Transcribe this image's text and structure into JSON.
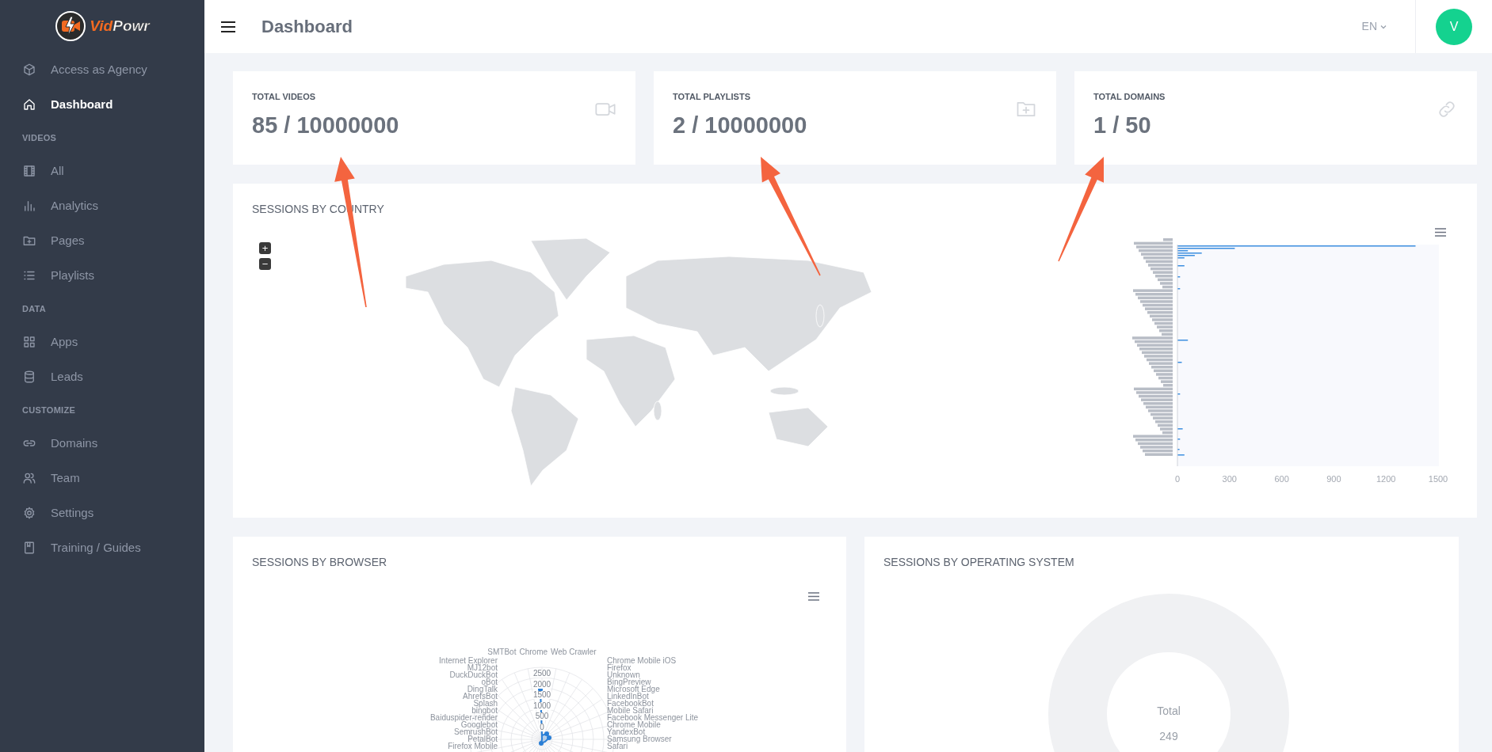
{
  "sidebar": {
    "logo": [
      "Vid",
      "Powr"
    ],
    "items": [
      {
        "kind": "link",
        "label": "Access as Agency",
        "selected": false
      },
      {
        "kind": "link",
        "label": "Dashboard",
        "selected": true
      },
      {
        "kind": "section",
        "label": "VIDEOS"
      },
      {
        "kind": "link",
        "label": "All",
        "selected": false
      },
      {
        "kind": "link",
        "label": "Analytics",
        "selected": false
      },
      {
        "kind": "link",
        "label": "Pages",
        "selected": false
      },
      {
        "kind": "link",
        "label": "Playlists",
        "selected": false
      },
      {
        "kind": "section",
        "label": "DATA"
      },
      {
        "kind": "link",
        "label": "Apps",
        "selected": false
      },
      {
        "kind": "link",
        "label": "Leads",
        "selected": false
      },
      {
        "kind": "section",
        "label": "CUSTOMIZE"
      },
      {
        "kind": "link",
        "label": "Domains",
        "selected": false
      },
      {
        "kind": "link",
        "label": "Team",
        "selected": false
      },
      {
        "kind": "link",
        "label": "Settings",
        "selected": false
      },
      {
        "kind": "link",
        "label": "Training / Guides",
        "selected": false
      }
    ]
  },
  "header": {
    "title": "Dashboard",
    "language": "EN",
    "avatar": "V"
  },
  "stats": [
    {
      "label": "TOTAL VIDEOS",
      "value": "85 / 10000000"
    },
    {
      "label": "TOTAL PLAYLISTS",
      "value": "2 / 10000000"
    },
    {
      "label": "TOTAL DOMAINS",
      "value": "1 / 50"
    }
  ],
  "country": {
    "title": "SESSIONS BY COUNTRY",
    "zoom_in": "+",
    "zoom_out": "−",
    "city_chart": {
      "xticks": [
        "0",
        "300",
        "600",
        "900",
        "1200",
        "1500"
      ]
    }
  },
  "browser": {
    "title": "SESSIONS BY BROWSER",
    "radar": {
      "top_labels": [
        "SMTBot",
        "Chrome",
        "Web Crawler"
      ],
      "left_labels": [
        "Internet Explorer",
        "MJ12bot",
        "DuckDuckBot",
        "oBot",
        "DingTalk",
        "AhrefsBot",
        "Splash",
        "bingbot",
        "Baiduspider-render",
        "Googlebot",
        "SemrushBot",
        "PetalBot",
        "Firefox Mobile"
      ],
      "right_labels": [
        "Chrome Mobile iOS",
        "Firefox",
        "Unknown",
        "BingPreview",
        "Microsoft Edge",
        "LinkedInBot",
        "FacebookBot",
        "Mobile Safari",
        "Facebook Messenger Lite",
        "Chrome Mobile",
        "YandexBot",
        "Samsung Browser",
        "Safari"
      ],
      "ticks": [
        "2500",
        "2000",
        "1500",
        "1000",
        "500",
        "0"
      ]
    }
  },
  "os": {
    "title": "SESSIONS BY OPERATING SYSTEM",
    "total_label": "Total",
    "total": "249"
  },
  "annotation_arrows": [
    {
      "kind": "arrow"
    },
    {
      "kind": "arrow"
    },
    {
      "kind": "arrow"
    }
  ]
}
